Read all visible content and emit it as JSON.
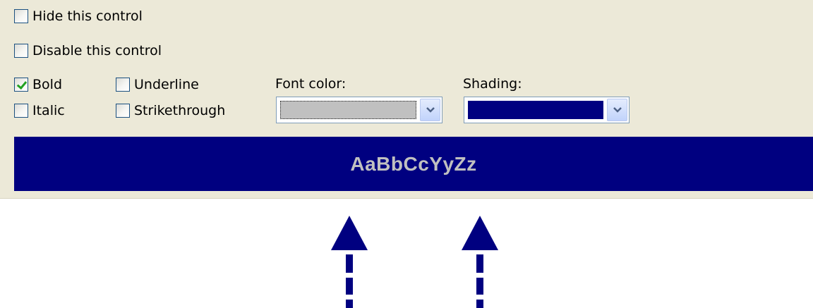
{
  "controls": {
    "hide": {
      "label": "Hide this control",
      "checked": false
    },
    "disable": {
      "label": "Disable this control",
      "checked": false
    },
    "bold": {
      "label": "Bold",
      "checked": true
    },
    "italic": {
      "label": "Italic",
      "checked": false
    },
    "underline": {
      "label": "Underline",
      "checked": false
    },
    "strikethrough": {
      "label": "Strikethrough",
      "checked": false
    }
  },
  "font_color": {
    "label": "Font color:",
    "value_color": "#c0c0c0"
  },
  "shading": {
    "label": "Shading:",
    "value_color": "#000080"
  },
  "preview": {
    "text": "AaBbCcYyZz",
    "text_color": "#c0c0c0",
    "background": "#000080"
  },
  "colors": {
    "panel": "#ece9d8",
    "arrow": "#000080",
    "checkmark": "#21a121"
  },
  "icons": {
    "dropdown": "chevron-down-icon",
    "annotation": "arrow-up-icon"
  }
}
